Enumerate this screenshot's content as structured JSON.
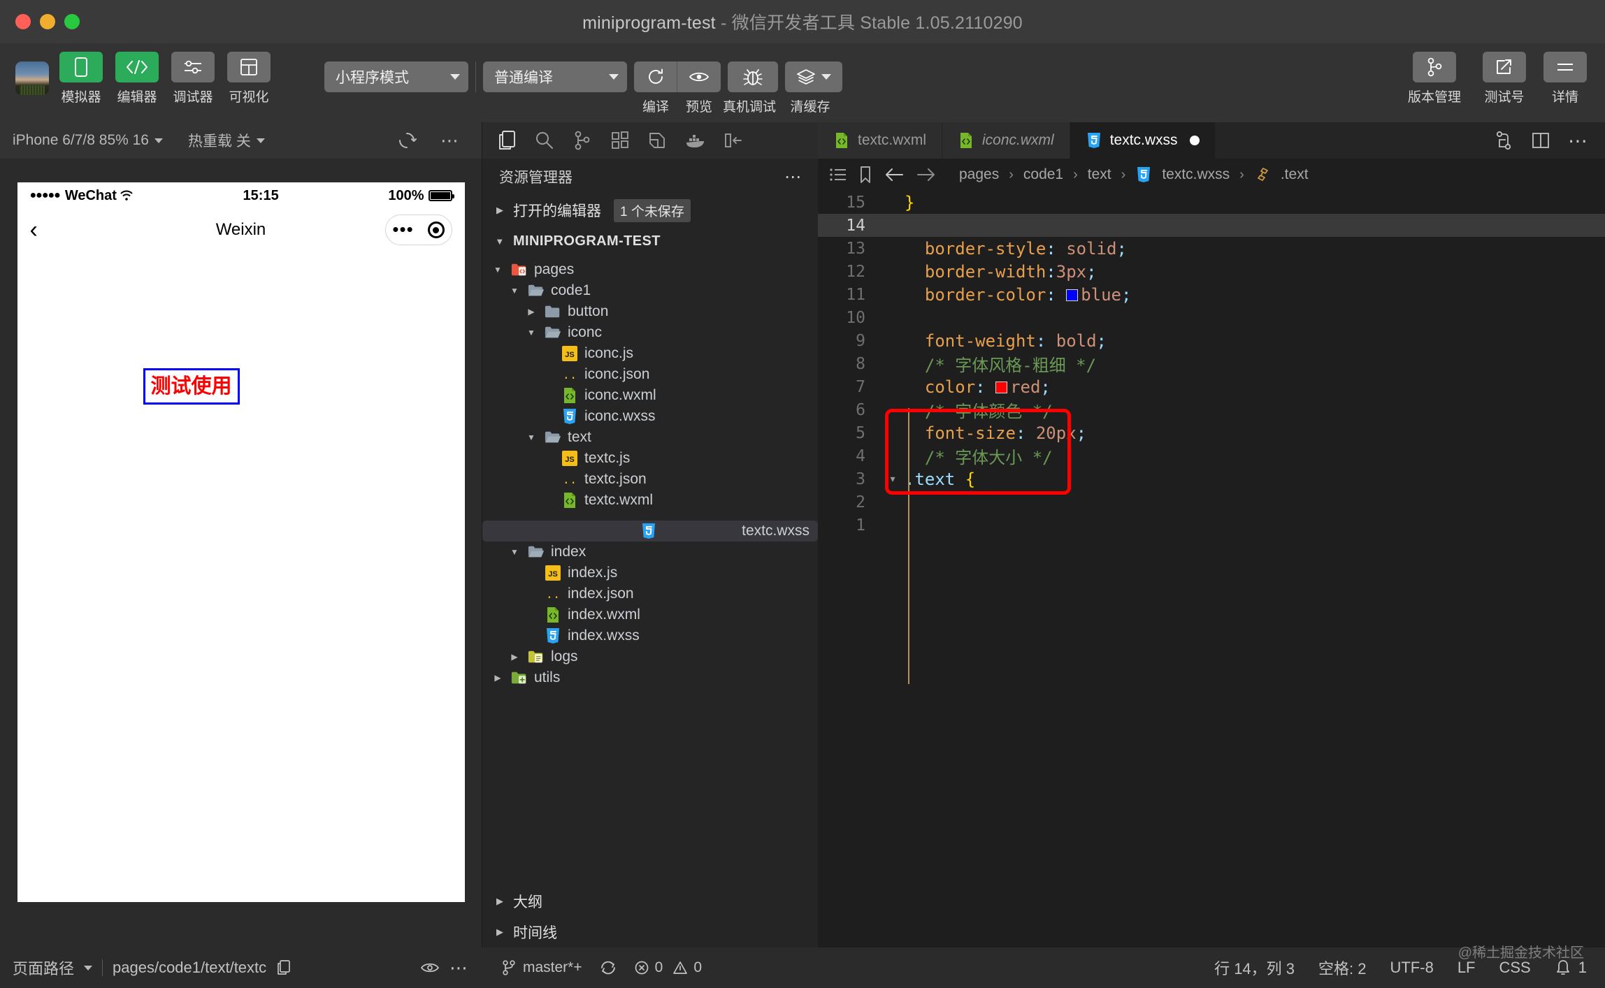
{
  "window": {
    "title_project": "miniprogram-test",
    "title_sep": " - ",
    "title_app": "微信开发者工具 Stable 1.05.2110290"
  },
  "toolbar": {
    "left_buttons": [
      {
        "label": "模拟器",
        "icon": "phone-icon",
        "style": "green"
      },
      {
        "label": "编辑器",
        "icon": "code-icon",
        "style": "green"
      },
      {
        "label": "调试器",
        "icon": "sliders-icon",
        "style": "gray"
      },
      {
        "label": "可视化",
        "icon": "layout-icon",
        "style": "gray"
      }
    ],
    "mode_select": "小程序模式",
    "compile_select": "普通编译",
    "actions": [
      {
        "label": "编译",
        "icon": "refresh-icon"
      },
      {
        "label": "预览",
        "icon": "eye-icon"
      },
      {
        "label": "真机调试",
        "icon": "bug-icon"
      },
      {
        "label": "清缓存",
        "icon": "layers-icon"
      }
    ],
    "right_buttons": [
      {
        "label": "版本管理",
        "icon": "branch-icon"
      },
      {
        "label": "测试号",
        "icon": "external-link-icon"
      },
      {
        "label": "详情",
        "icon": "menu-icon"
      }
    ]
  },
  "simulator": {
    "device_select": "iPhone 6/7/8 85% 16",
    "hot_reload": "热重载 关",
    "phone": {
      "carrier_dots": "●●●●●",
      "carrier": "WeChat",
      "time": "15:15",
      "battery_pct": "100%",
      "nav_title": "Weixin",
      "page_text": "测试使用"
    },
    "footer": {
      "page_path_label": "页面路径",
      "page_path_value": "pages/code1/text/textc"
    }
  },
  "explorer": {
    "activity_icons": [
      "files-icon",
      "search-icon",
      "source-control-icon",
      "extensions-icon",
      "debug-icon",
      "docker-icon",
      "collapse-icon"
    ],
    "title": "资源管理器",
    "open_editors": {
      "label": "打开的编辑器",
      "badge": "1 个未保存"
    },
    "project_name": "MINIPROGRAM-TEST",
    "tree": [
      {
        "label": "pages",
        "type": "folder-pages",
        "depth": 1,
        "expanded": true
      },
      {
        "label": "code1",
        "type": "folder",
        "depth": 2,
        "expanded": true
      },
      {
        "label": "button",
        "type": "folder",
        "depth": 3,
        "expanded": false
      },
      {
        "label": "iconc",
        "type": "folder",
        "depth": 3,
        "expanded": true
      },
      {
        "label": "iconc.js",
        "type": "js",
        "depth": 4
      },
      {
        "label": "iconc.json",
        "type": "json",
        "depth": 4
      },
      {
        "label": "iconc.wxml",
        "type": "wxml",
        "depth": 4
      },
      {
        "label": "iconc.wxss",
        "type": "wxss",
        "depth": 4
      },
      {
        "label": "text",
        "type": "folder",
        "depth": 3,
        "expanded": true
      },
      {
        "label": "textc.js",
        "type": "js",
        "depth": 4
      },
      {
        "label": "textc.json",
        "type": "json",
        "depth": 4
      },
      {
        "label": "textc.wxml",
        "type": "wxml",
        "depth": 4
      },
      {
        "label": "textc.wxss",
        "type": "wxss",
        "depth": 4,
        "selected": true
      },
      {
        "label": "index",
        "type": "folder",
        "depth": 2,
        "expanded": true
      },
      {
        "label": "index.js",
        "type": "js",
        "depth": 3
      },
      {
        "label": "index.json",
        "type": "json",
        "depth": 3
      },
      {
        "label": "index.wxml",
        "type": "wxml",
        "depth": 3
      },
      {
        "label": "index.wxss",
        "type": "wxss",
        "depth": 3
      },
      {
        "label": "logs",
        "type": "folder-logs",
        "depth": 2,
        "expanded": false
      },
      {
        "label": "utils",
        "type": "folder-utils",
        "depth": 1,
        "expanded": false
      }
    ],
    "outline": "大纲",
    "timeline": "时间线"
  },
  "editor": {
    "tabs": [
      {
        "label": "textc.wxml",
        "type": "wxml",
        "active": false,
        "italic": false,
        "dirty": false
      },
      {
        "label": "iconc.wxml",
        "type": "wxml",
        "active": false,
        "italic": true,
        "dirty": false
      },
      {
        "label": "textc.wxss",
        "type": "wxss",
        "active": true,
        "italic": false,
        "dirty": true
      }
    ],
    "breadcrumb": [
      "pages",
      "code1",
      "text",
      "textc.wxss",
      ".text"
    ],
    "lines": [
      {
        "n": "1",
        "segments": []
      },
      {
        "n": "2",
        "segments": []
      },
      {
        "n": "3",
        "fold": "▾",
        "segments": [
          {
            "t": ".text ",
            "c": "k-sel"
          },
          {
            "t": "{",
            "c": "k-brace"
          }
        ]
      },
      {
        "n": "4",
        "segments": [
          {
            "t": "  /* 字体大小 */",
            "c": "k-com"
          }
        ]
      },
      {
        "n": "5",
        "segments": [
          {
            "t": "  font-size",
            "c": "k-prop"
          },
          {
            "t": ": ",
            "c": "k-colon"
          },
          {
            "t": "20px",
            "c": "k-num"
          },
          {
            "t": ";",
            "c": "k-colon"
          }
        ]
      },
      {
        "n": "6",
        "segments": [
          {
            "t": "  /* 字体颜色 */",
            "c": "k-com"
          }
        ]
      },
      {
        "n": "7",
        "segments": [
          {
            "t": "  color",
            "c": "k-prop"
          },
          {
            "t": ": ",
            "c": "k-colon"
          },
          {
            "t": "red",
            "c": "k-val",
            "swatch": "#ff0000"
          },
          {
            "t": ";",
            "c": "k-colon"
          }
        ]
      },
      {
        "n": "8",
        "segments": [
          {
            "t": "  /* 字体风格-粗细 */",
            "c": "k-com"
          }
        ]
      },
      {
        "n": "9",
        "segments": [
          {
            "t": "  font-weight",
            "c": "k-prop"
          },
          {
            "t": ": ",
            "c": "k-colon"
          },
          {
            "t": "bold",
            "c": "k-val"
          },
          {
            "t": ";",
            "c": "k-colon"
          }
        ]
      },
      {
        "n": "10",
        "segments": []
      },
      {
        "n": "11",
        "segments": [
          {
            "t": "  border-color",
            "c": "k-prop"
          },
          {
            "t": ": ",
            "c": "k-colon"
          },
          {
            "t": "blue",
            "c": "k-val",
            "swatch": "#0000ff"
          },
          {
            "t": ";",
            "c": "k-colon"
          }
        ]
      },
      {
        "n": "12",
        "segments": [
          {
            "t": "  border-width",
            "c": "k-prop"
          },
          {
            "t": ":",
            "c": "k-colon"
          },
          {
            "t": "3px",
            "c": "k-num"
          },
          {
            "t": ";",
            "c": "k-colon"
          }
        ]
      },
      {
        "n": "13",
        "segments": [
          {
            "t": "  border-style",
            "c": "k-prop"
          },
          {
            "t": ": ",
            "c": "k-colon"
          },
          {
            "t": "solid",
            "c": "k-val"
          },
          {
            "t": ";",
            "c": "k-colon"
          }
        ]
      },
      {
        "n": "14",
        "current": true,
        "segments": []
      },
      {
        "n": "15",
        "segments": [
          {
            "t": "}",
            "c": "k-brace"
          }
        ]
      }
    ],
    "annotation_color": "#ff0000"
  },
  "status_bar": {
    "branch": "master*+",
    "errors": "0",
    "warnings": "0",
    "cursor": "行 14，列 3",
    "spaces": "空格: 2",
    "encoding": "UTF-8",
    "eol": "LF",
    "language": "CSS",
    "notifications": "1"
  },
  "watermark": "@稀土掘金技术社区",
  "colors": {
    "accent_green": "#2cab5a",
    "annotation_red": "#ff0000",
    "text_red": "#ff0000",
    "border_blue": "#0000ff"
  }
}
